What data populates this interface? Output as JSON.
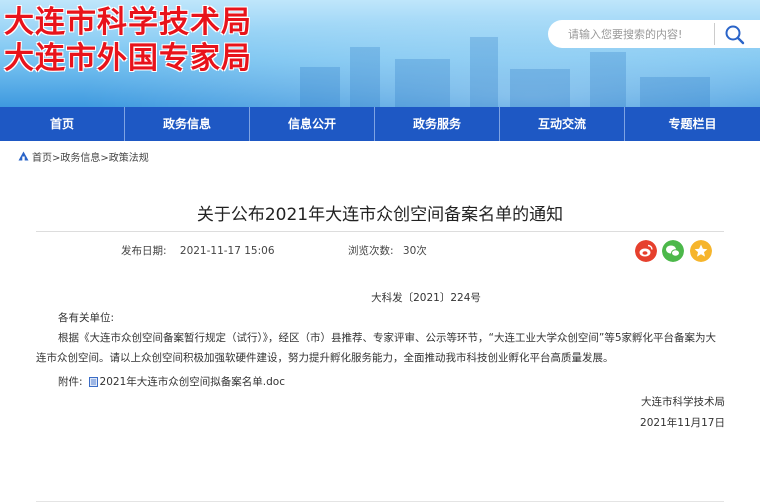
{
  "header": {
    "title_line1": "大连市科学技术局",
    "title_line2": "大连市外国专家局",
    "search_placeholder": "请输入您要搜索的内容!",
    "search_icon": "search-icon",
    "title_color": "#e8131b"
  },
  "nav": {
    "items": [
      "首页",
      "政务信息",
      "信息公开",
      "政务服务",
      "互动交流",
      "专题栏目"
    ],
    "color": "#1e58c4"
  },
  "breadcrumb": {
    "text": "首页>政务信息>政策法规"
  },
  "article": {
    "title": "关于公布2021年大连市众创空间备案名单的通知",
    "publish_label": "发布日期:",
    "publish_value": "2021-11-17  15:06",
    "views_label": "浏览次数:",
    "views_value": "30次",
    "doc_number": "大科发〔2021〕224号",
    "salutation": "各有关单位:",
    "paragraph": "根据《大连市众创空间备案暂行规定（试行）》，经区（市）县推荐、专家评审、公示等环节，“大连工业大学众创空间”等5家孵化平台备案为大连市众创空间。请以上众创空间积极加强软硬件建设，努力提升孵化服务能力，全面推动我市科技创业孵化平台高质量发展。",
    "attachment_label": "附件:",
    "attachment_file": "2021年大连市众创空间拟备案名单.doc",
    "signature_org": "大连市科学技术局",
    "signature_date": "2021年11月17日"
  },
  "share": {
    "weibo_icon": "weibo-icon",
    "wechat_icon": "wechat-icon",
    "favorite_icon": "star-icon",
    "weibo_color": "#e6402d",
    "wechat_color": "#4cb84a",
    "favorite_color": "#f6b52c"
  }
}
